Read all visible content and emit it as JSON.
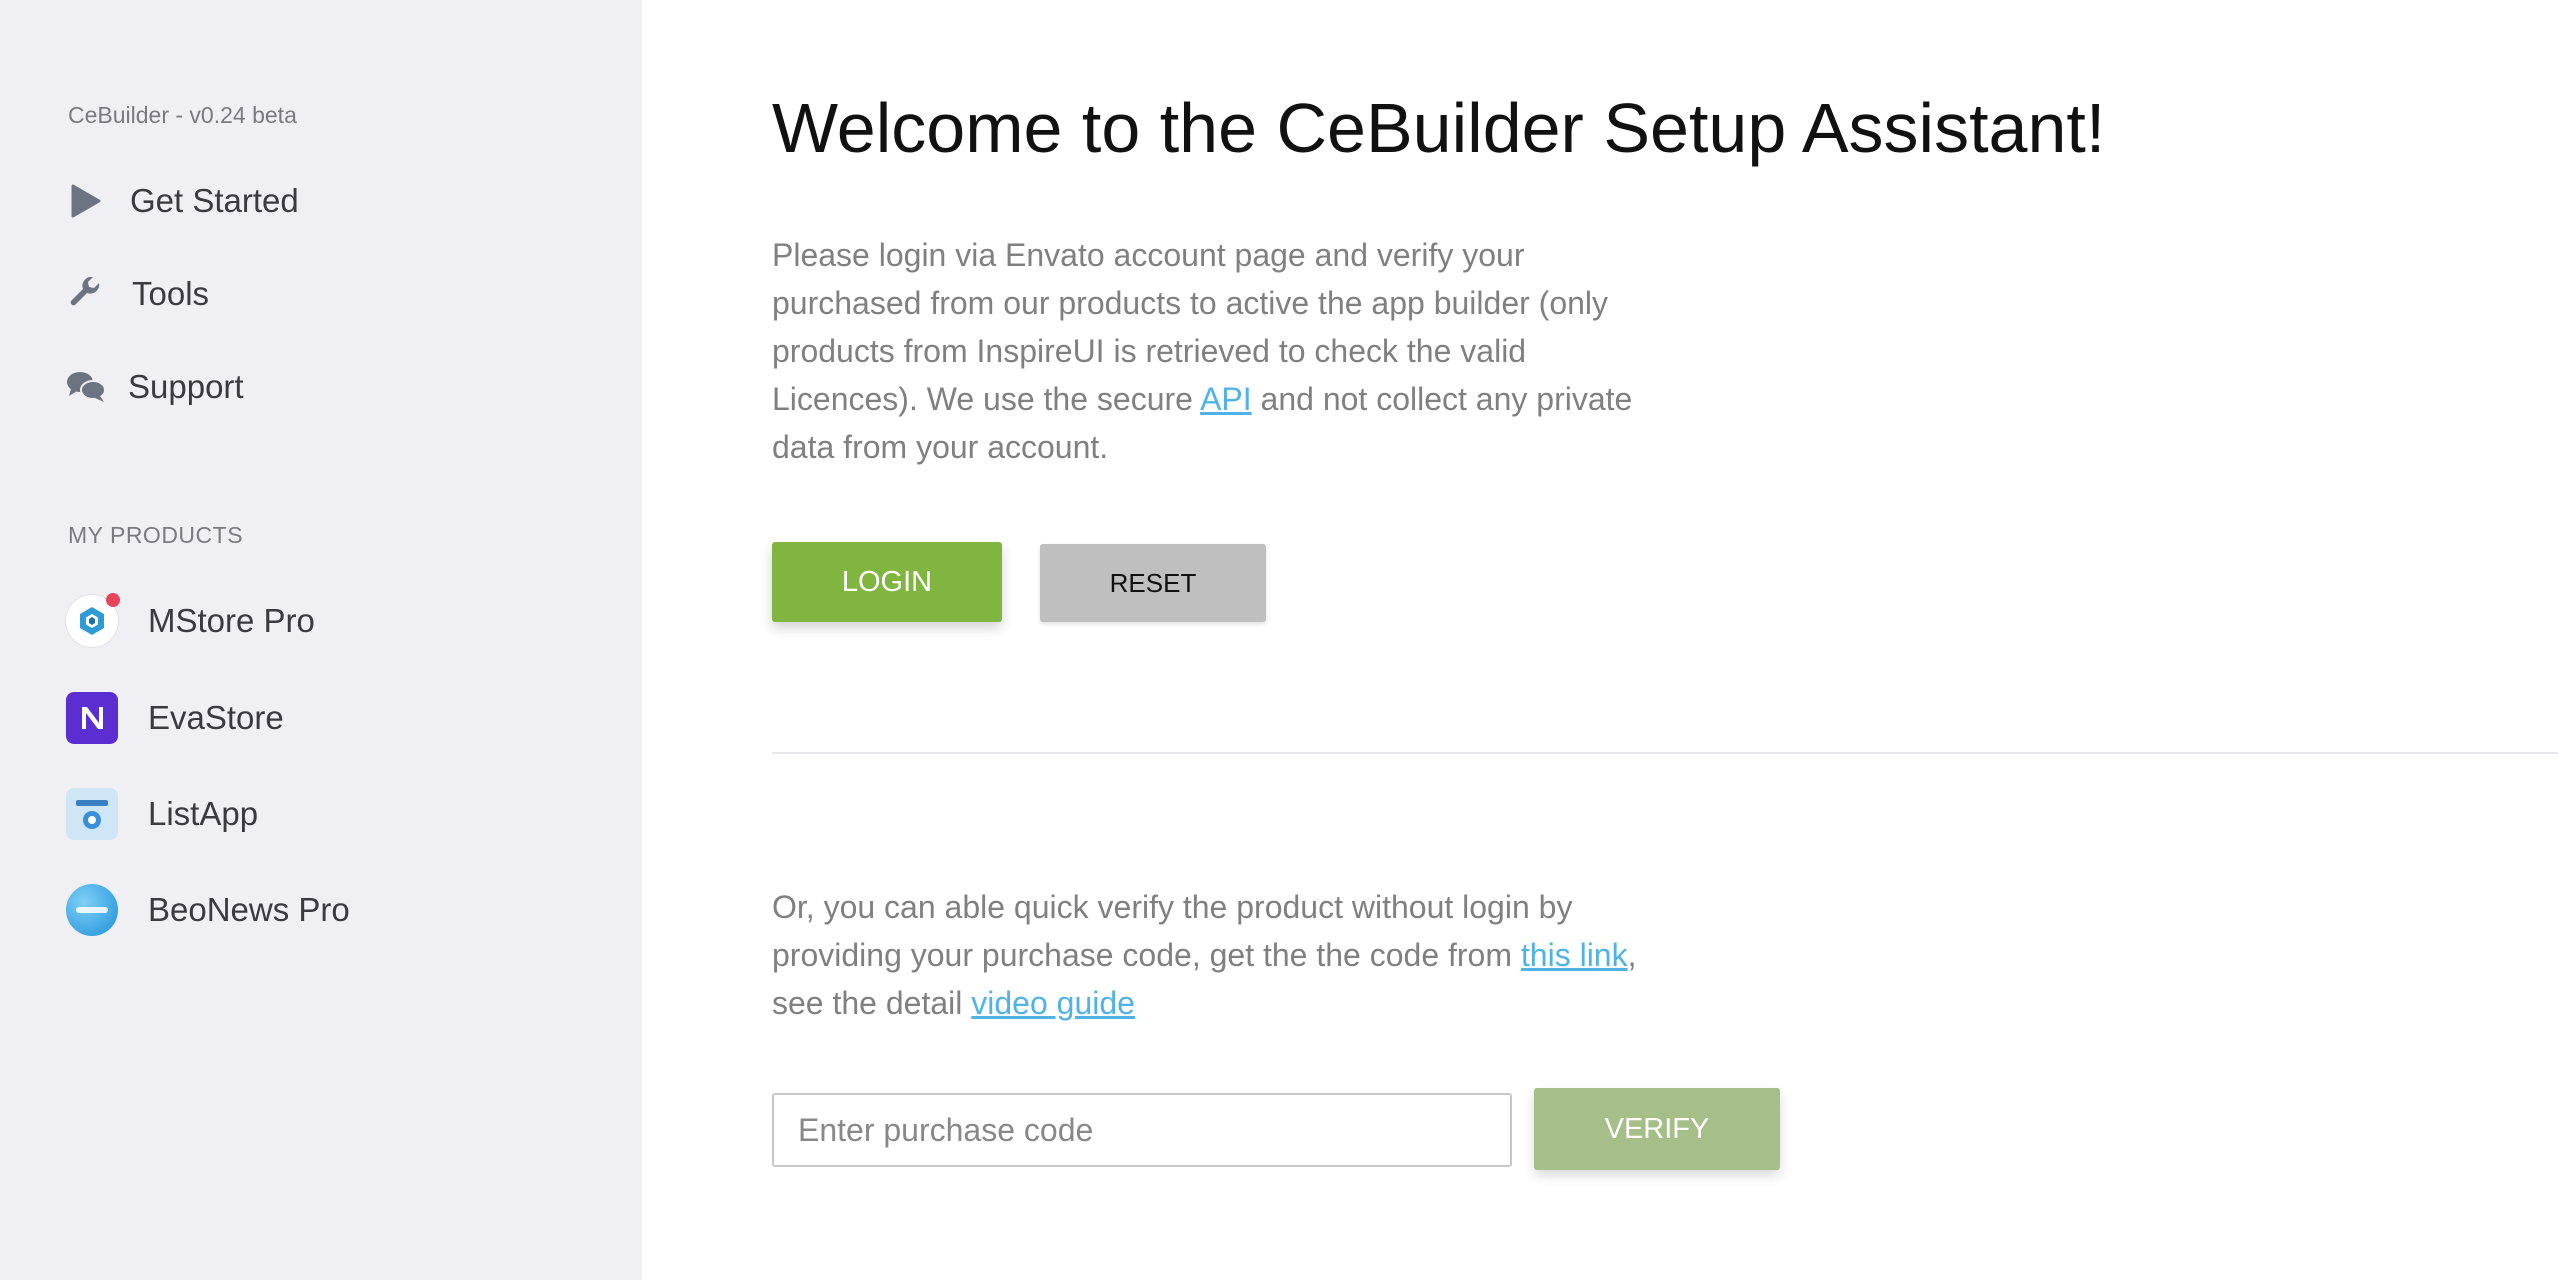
{
  "sidebar": {
    "version": "CeBuilder - v0.24 beta",
    "nav": [
      {
        "label": "Get Started",
        "icon": "play-icon"
      },
      {
        "label": "Tools",
        "icon": "wrench-icon"
      },
      {
        "label": "Support",
        "icon": "chat-bubbles-icon"
      }
    ],
    "products_title": "MY PRODUCTS",
    "products": [
      {
        "label": "MStore Pro",
        "icon": "mstore-logo-icon"
      },
      {
        "label": "EvaStore",
        "icon": "evastore-logo-icon"
      },
      {
        "label": "ListApp",
        "icon": "listapp-logo-icon"
      },
      {
        "label": "BeoNews Pro",
        "icon": "beonews-logo-icon"
      }
    ]
  },
  "main": {
    "title": "Welcome to the CeBuilder Setup Assistant!",
    "intro": {
      "text_before": "Please login via Envato account page and verify your purchased from our products to active the app builder (only products from InspireUI is retrieved to check the valid Licences). We use the secure ",
      "link": "API",
      "text_after": " and not collect any private data from your account."
    },
    "login_label": "LOGIN",
    "reset_label": "RESET",
    "quick": {
      "text_before": "Or, you can able quick verify the product without login by providing your purchase code, get the the code from ",
      "link1": "this link",
      "text_middle": ", see the detail ",
      "link2": "video guide"
    },
    "purchase_placeholder": "Enter purchase code",
    "verify_label": "VERIFY"
  },
  "colors": {
    "sidebar_bg": "#f0f0f4",
    "login": "#80b540",
    "reset": "#bfbfbf",
    "verify": "#a6bf89",
    "link": "#4fb3e8"
  }
}
